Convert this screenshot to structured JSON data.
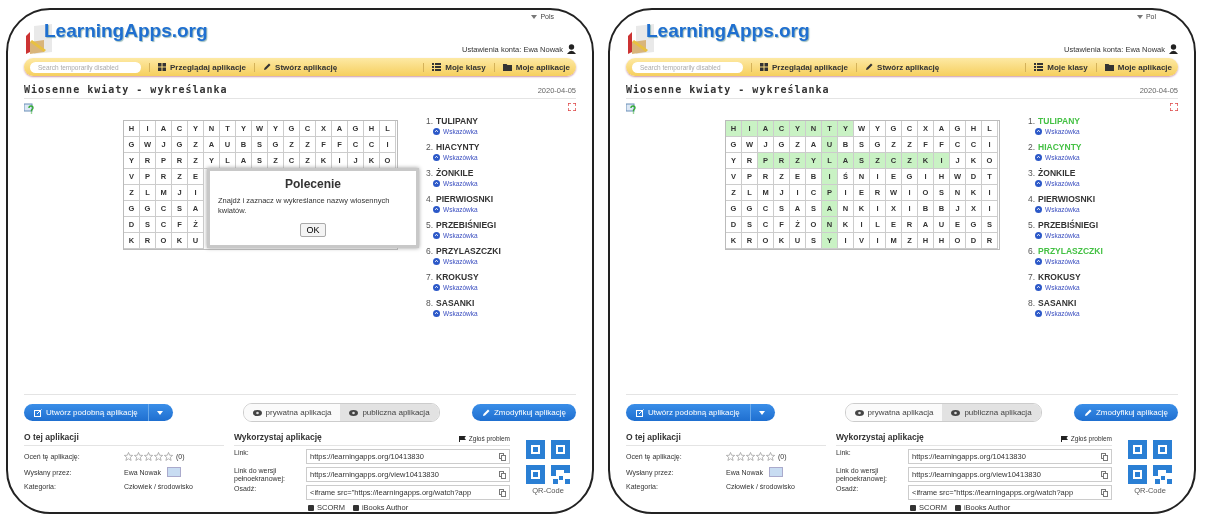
{
  "panels": [
    {
      "header": {
        "logo": "LearningApps.org",
        "language": "Pols",
        "account": "Ustawienia konta: Ewa Nowak"
      },
      "nav": {
        "search_placeholder": "Search temporarily disabled",
        "items": [
          {
            "label": "Przeglądaj aplikacje",
            "kind": "grid"
          },
          {
            "label": "Stwórz aplikację",
            "kind": "pencil"
          }
        ],
        "right_items": [
          {
            "label": "Moje klasy",
            "kind": "list"
          },
          {
            "label": "Moje aplikacje",
            "kind": "folder"
          }
        ]
      },
      "title": "Wiosenne kwiaty - wykreślanka",
      "date": "2020-04-05",
      "grid": {
        "rows": [
          {
            "letters": [
              "H",
              "I",
              "A",
              "C",
              "Y",
              "N",
              "T",
              "Y",
              "W",
              "Y",
              "G",
              "C",
              "X",
              "A",
              "G",
              "H",
              "L"
            ],
            "found": [
              false,
              false,
              false,
              false,
              false,
              false,
              false,
              false,
              false,
              false,
              false,
              false,
              false,
              false,
              false,
              false,
              false
            ]
          },
          {
            "letters": [
              "G",
              "W",
              "J",
              "G",
              "Z",
              "A",
              "U",
              "B",
              "S",
              "G",
              "Z",
              "Z",
              "F",
              "F",
              "C",
              "C",
              "I"
            ],
            "found": [
              false,
              false,
              false,
              false,
              false,
              false,
              false,
              false,
              false,
              false,
              false,
              false,
              false,
              false,
              false,
              false,
              false
            ]
          },
          {
            "letters": [
              "Y",
              "R",
              "P",
              "R",
              "Z",
              "Y",
              "L",
              "A",
              "S",
              "Z",
              "C",
              "Z",
              "K",
              "I",
              "J",
              "K",
              "O"
            ],
            "found": [
              false,
              false,
              false,
              false,
              false,
              false,
              false,
              false,
              false,
              false,
              false,
              false,
              false,
              false,
              false,
              false,
              false
            ]
          },
          {
            "letters": [
              "V",
              "P",
              "R",
              "Z",
              "E"
            ],
            "found": [
              false,
              false,
              false,
              false,
              false
            ]
          },
          {
            "letters": [
              "Z",
              "L",
              "M",
              "J",
              "I"
            ],
            "found": [
              false,
              false,
              false,
              false,
              false
            ]
          },
          {
            "letters": [
              "G",
              "G",
              "C",
              "S",
              "A"
            ],
            "found": [
              false,
              false,
              false,
              false,
              false
            ]
          },
          {
            "letters": [
              "D",
              "S",
              "C",
              "F",
              "Ż"
            ],
            "found": [
              false,
              false,
              false,
              false,
              false
            ]
          },
          {
            "letters": [
              "K",
              "R",
              "O",
              "K",
              "U"
            ],
            "found": [
              false,
              false,
              false,
              false,
              false
            ]
          }
        ]
      },
      "dialog": {
        "title": "Polecenie",
        "text": "Znajdź i zaznacz w wykreślance nazwy wiosennych kwiatów.",
        "button": "OK"
      },
      "words": [
        {
          "number": "1.",
          "word": "TULIPANY",
          "found": false,
          "hint": "Wskazówka"
        },
        {
          "number": "2.",
          "word": "HIACYNTY",
          "found": false,
          "hint": "Wskazówka"
        },
        {
          "number": "3.",
          "word": "ŻONKILE",
          "found": false,
          "hint": "Wskazówka"
        },
        {
          "number": "4.",
          "word": "PIERWIOSNKI",
          "found": false,
          "hint": "Wskazówka"
        },
        {
          "number": "5.",
          "word": "PRZEBIŚNIEGI",
          "found": false,
          "hint": "Wskazówka"
        },
        {
          "number": "6.",
          "word": "PRZYLASZCZKI",
          "found": false,
          "hint": "Wskazówka"
        },
        {
          "number": "7.",
          "word": "KROKUSY",
          "found": false,
          "hint": "Wskazówka"
        },
        {
          "number": "8.",
          "word": "SASANKI",
          "found": false,
          "hint": "Wskazówka"
        }
      ],
      "actions": {
        "create_similar": "Utwórz podobną aplikację",
        "visibility": [
          {
            "label": "prywatna aplikacja",
            "selected": false
          },
          {
            "label": "publiczna aplikacja",
            "selected": true
          }
        ],
        "modify": "Zmodyfikuj aplikację"
      },
      "about": {
        "heading": "O tej aplikacji",
        "rating_label": "Oceń tę aplikację:",
        "stars": 0,
        "rating_count": "(0)",
        "author_label": "Wysłany przez:",
        "author": "Ewa Nowak",
        "category_label": "Kategoria:",
        "category": "Człowiek / środowisko"
      },
      "use": {
        "heading": "Wykorzystaj aplikację",
        "report": "Zgłoś problem",
        "fields": [
          {
            "label": "Link:",
            "value": "https://learningapps.org/10413830"
          },
          {
            "label": "Link do wersji pełnoekranowej:",
            "value": "https://learningapps.org/view10413830"
          },
          {
            "label": "Osadź:",
            "value": "<iframe src=\"https://learningapps.org/watch?app"
          }
        ],
        "exports": [
          "SCORM",
          "iBooks Author"
        ],
        "qr_label": "QR-Code"
      }
    },
    {
      "header": {
        "logo": "LearningApps.org",
        "language": "Pol",
        "account": "Ustawienia konta: Ewa Nowak"
      },
      "nav": {
        "search_placeholder": "Search temporarily disabled",
        "items": [
          {
            "label": "Przeglądaj aplikacje",
            "kind": "grid"
          },
          {
            "label": "Stwórz aplikację",
            "kind": "pencil"
          }
        ],
        "right_items": [
          {
            "label": "Moje klasy",
            "kind": "list"
          },
          {
            "label": "Moje aplikacje",
            "kind": "folder"
          }
        ]
      },
      "title": "Wiosenne kwiaty - wykreślanka",
      "date": "2020-04-05",
      "grid": {
        "rows": [
          {
            "letters": [
              "H",
              "I",
              "A",
              "C",
              "Y",
              "N",
              "T",
              "Y",
              "W",
              "Y",
              "G",
              "C",
              "X",
              "A",
              "G",
              "H",
              "L"
            ],
            "found": [
              true,
              true,
              true,
              true,
              true,
              true,
              true,
              true,
              false,
              false,
              false,
              false,
              false,
              false,
              false,
              false,
              false
            ]
          },
          {
            "letters": [
              "G",
              "W",
              "J",
              "G",
              "Z",
              "A",
              "U",
              "B",
              "S",
              "G",
              "Z",
              "Z",
              "F",
              "F",
              "C",
              "C",
              "I"
            ],
            "found": [
              false,
              false,
              false,
              false,
              false,
              false,
              true,
              false,
              false,
              false,
              false,
              false,
              false,
              false,
              false,
              false,
              false
            ]
          },
          {
            "letters": [
              "Y",
              "R",
              "P",
              "R",
              "Z",
              "Y",
              "L",
              "A",
              "S",
              "Z",
              "C",
              "Z",
              "K",
              "I",
              "J",
              "K",
              "O"
            ],
            "found": [
              false,
              false,
              true,
              true,
              true,
              true,
              true,
              true,
              true,
              true,
              true,
              true,
              true,
              true,
              false,
              false,
              false
            ]
          },
          {
            "letters": [
              "V",
              "P",
              "R",
              "Z",
              "E",
              "B",
              "I",
              "Ś",
              "N",
              "I",
              "E",
              "G",
              "I",
              "H",
              "W",
              "D",
              "T"
            ],
            "found": [
              false,
              false,
              false,
              false,
              false,
              false,
              true,
              false,
              false,
              false,
              false,
              false,
              false,
              false,
              false,
              false,
              false
            ]
          },
          {
            "letters": [
              "Z",
              "L",
              "M",
              "J",
              "I",
              "C",
              "P",
              "I",
              "E",
              "R",
              "W",
              "I",
              "O",
              "S",
              "N",
              "K",
              "I"
            ],
            "found": [
              false,
              false,
              false,
              false,
              false,
              false,
              true,
              false,
              false,
              false,
              false,
              false,
              false,
              false,
              false,
              false,
              false
            ]
          },
          {
            "letters": [
              "G",
              "G",
              "C",
              "S",
              "A",
              "S",
              "A",
              "N",
              "K",
              "I",
              "X",
              "I",
              "B",
              "B",
              "J",
              "X",
              "I"
            ],
            "found": [
              false,
              false,
              false,
              false,
              false,
              false,
              true,
              false,
              false,
              false,
              false,
              false,
              false,
              false,
              false,
              false,
              false
            ]
          },
          {
            "letters": [
              "D",
              "S",
              "C",
              "F",
              "Ż",
              "O",
              "N",
              "K",
              "I",
              "L",
              "E",
              "R",
              "A",
              "U",
              "E",
              "G",
              "S"
            ],
            "found": [
              false,
              false,
              false,
              false,
              false,
              false,
              true,
              false,
              false,
              false,
              false,
              false,
              false,
              false,
              false,
              false,
              false
            ]
          },
          {
            "letters": [
              "K",
              "R",
              "O",
              "K",
              "U",
              "S",
              "Y",
              "I",
              "V",
              "I",
              "M",
              "Z",
              "H",
              "H",
              "O",
              "D",
              "R"
            ],
            "found": [
              false,
              false,
              false,
              false,
              false,
              false,
              true,
              false,
              false,
              false,
              false,
              false,
              false,
              false,
              false,
              false,
              false
            ]
          }
        ]
      },
      "words": [
        {
          "number": "1.",
          "word": "TULIPANY",
          "found": true,
          "hint": "Wskazówka"
        },
        {
          "number": "2.",
          "word": "HIACYNTY",
          "found": true,
          "hint": "Wskazówka"
        },
        {
          "number": "3.",
          "word": "ŻONKILE",
          "found": false,
          "hint": "Wskazówka"
        },
        {
          "number": "4.",
          "word": "PIERWIOSNKI",
          "found": false,
          "hint": "Wskazówka"
        },
        {
          "number": "5.",
          "word": "PRZEBIŚNIEGI",
          "found": false,
          "hint": "Wskazówka"
        },
        {
          "number": "6.",
          "word": "PRZYLASZCZKI",
          "found": true,
          "hint": "Wskazówka"
        },
        {
          "number": "7.",
          "word": "KROKUSY",
          "found": false,
          "hint": "Wskazówka"
        },
        {
          "number": "8.",
          "word": "SASANKI",
          "found": false,
          "hint": "Wskazówka"
        }
      ],
      "actions": {
        "create_similar": "Utwórz podobną aplikację",
        "visibility": [
          {
            "label": "prywatna aplikacja",
            "selected": false
          },
          {
            "label": "publiczna aplikacja",
            "selected": true
          }
        ],
        "modify": "Zmodyfikuj aplikację"
      },
      "about": {
        "heading": "O tej aplikacji",
        "rating_label": "Oceń tę aplikację:",
        "stars": 0,
        "rating_count": "(0)",
        "author_label": "Wysłany przez:",
        "author": "Ewa Nowak",
        "category_label": "Kategoria:",
        "category": "Człowiek / środowisko"
      },
      "use": {
        "heading": "Wykorzystaj aplikację",
        "report": "Zgłoś problem",
        "fields": [
          {
            "label": "Link:",
            "value": "https://learningapps.org/10413830"
          },
          {
            "label": "Link do wersji pełnoekranowej:",
            "value": "https://learningapps.org/view10413830"
          },
          {
            "label": "Osadź:",
            "value": "<iframe src=\"https://learningapps.org/watch?app"
          }
        ],
        "exports": [
          "SCORM",
          "iBooks Author"
        ],
        "qr_label": "QR-Code"
      }
    }
  ]
}
